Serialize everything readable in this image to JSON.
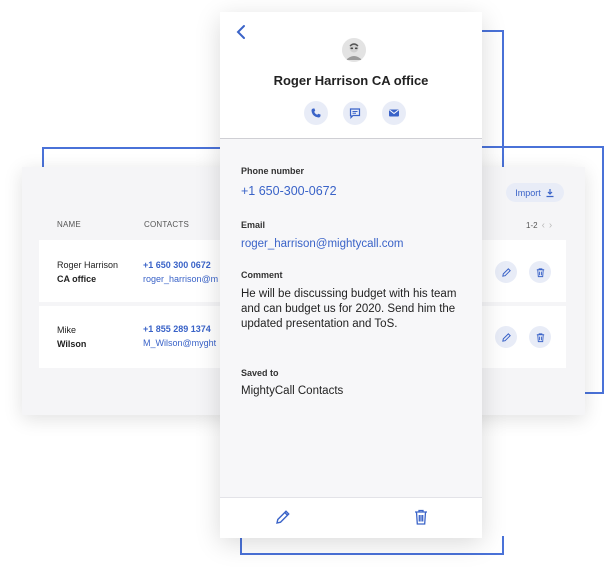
{
  "list": {
    "columns": {
      "name": "NAME",
      "contacts": "CONTACTS"
    },
    "import_label": "Import",
    "pager_label": "1-2",
    "rows": [
      {
        "first": "Roger Harrison",
        "second": "CA office",
        "phone": "+1 650 300 0672",
        "email": "roger_harrison@m"
      },
      {
        "first": "Mike",
        "second": "Wilson",
        "phone": "+1 855 289 1374",
        "email": "M_Wilson@myght"
      }
    ]
  },
  "detail": {
    "title": "Roger Harrison CA office",
    "phone_label": "Phone number",
    "phone_value": "+1 650-300-0672",
    "email_label": "Email",
    "email_value": "roger_harrison@mightycall.com",
    "comment_label": "Comment",
    "comment_value": "He will be discussing budget with his team and can budget us for 2020. Send him the updated presentation and ToS.",
    "saved_label": "Saved to",
    "saved_value": "MightyCall Contacts"
  },
  "colors": {
    "accent": "#3a63c8",
    "frame": "#4a72d8",
    "chip": "#e8ecf7"
  },
  "icons": [
    "back-chevron-icon",
    "avatar-icon",
    "phone-icon",
    "message-icon",
    "mail-icon",
    "edit-icon",
    "trash-icon",
    "download-icon",
    "chevron-left-icon",
    "chevron-right-icon"
  ]
}
